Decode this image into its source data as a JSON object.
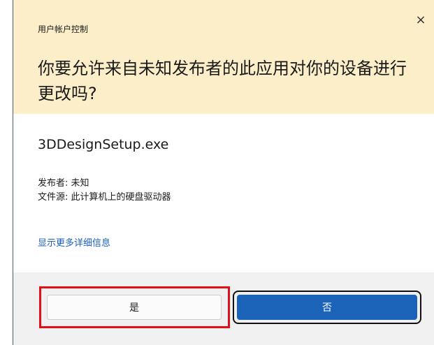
{
  "dialog": {
    "title": "用户帐户控制",
    "close_glyph": "×",
    "question": "你要允许来自未知发布者的此应用对你的设备进行更改吗?",
    "app_name": "3DDesignSetup.exe",
    "publisher": "发布者: 未知",
    "file_origin": "文件源: 此计算机上的硬盘驱动器",
    "details_link": "显示更多详细信息",
    "yes_label": "是",
    "no_label": "否"
  },
  "colors": {
    "header_bg": "#fbeec8",
    "link": "#1a5fc0",
    "primary_button": "#1a63b8",
    "highlight": "#e0101a"
  }
}
